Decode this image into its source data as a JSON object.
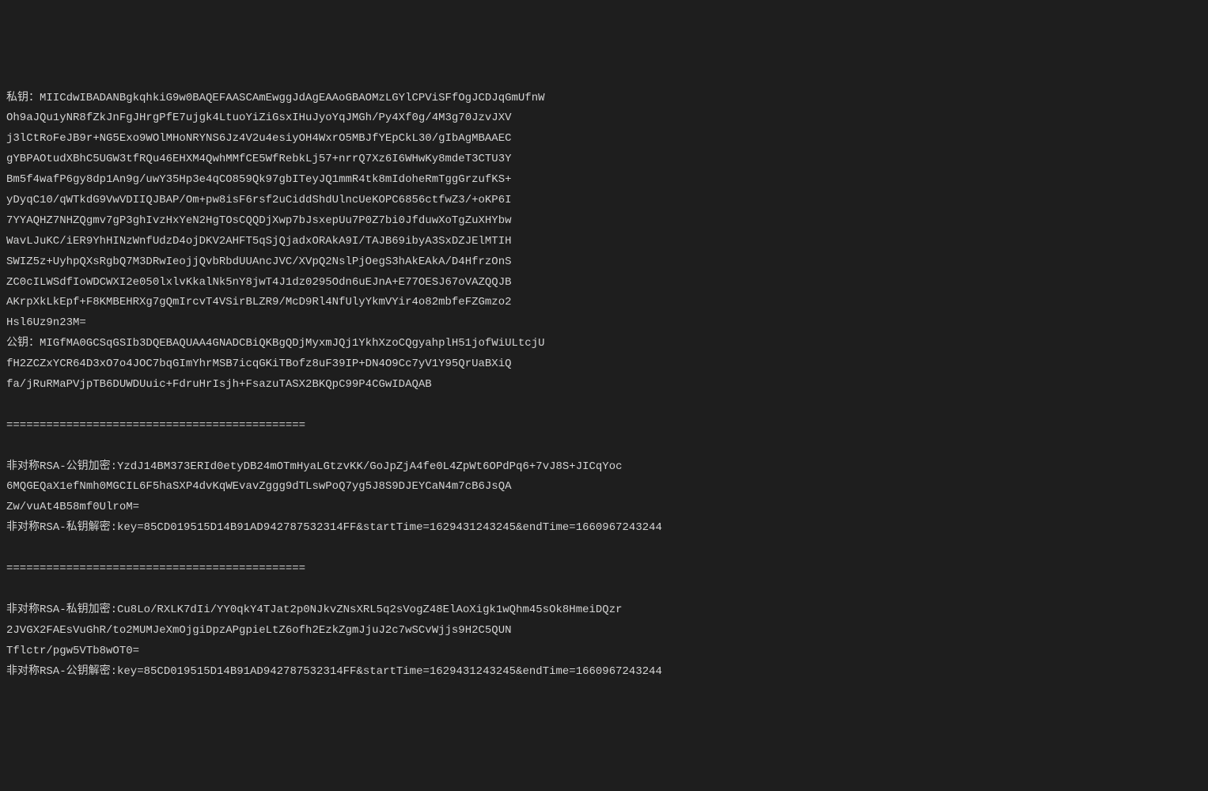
{
  "console": {
    "lines": [
      "私钥：MIICdwIBADANBgkqhkiG9w0BAQEFAASCAmEwggJdAgEAAoGBAOMzLGYlCPViSFfOgJCDJqGmUfnW",
      "Oh9aJQu1yNR8fZkJnFgJHrgPfE7ujgk4LtuoYiZiGsxIHuJyoYqJMGh/Py4Xf0g/4M3g70JzvJXV",
      "j3lCtRoFeJB9r+NG5Exo9WOlMHoNRYNS6Jz4V2u4esiyOH4WxrO5MBJfYEpCkL30/gIbAgMBAAEC",
      "gYBPAOtudXBhC5UGW3tfRQu46EHXM4QwhMMfCE5WfRebkLj57+nrrQ7Xz6I6WHwKy8mdeT3CTU3Y",
      "Bm5f4wafP6gy8dp1An9g/uwY35Hp3e4qCO859Qk97gbITeyJQ1mmR4tk8mIdoheRmTggGrzufKS+",
      "yDyqC10/qWTkdG9VwVDIIQJBAP/Om+pw8isF6rsf2uCiddShdUlncUeKOPC6856ctfwZ3/+oKP6I",
      "7YYAQHZ7NHZQgmv7gP3ghIvzHxYeN2HgTOsCQQDjXwp7bJsxepUu7P0Z7bi0JfduwXoTgZuXHYbw",
      "WavLJuKC/iER9YhHINzWnfUdzD4ojDKV2AHFT5qSjQjadxORAkA9I/TAJB69ibyA3SxDZJElMTIH",
      "SWIZ5z+UyhpQXsRgbQ7M3DRwIeojjQvbRbdUUAncJVC/XVpQ2NslPjOegS3hAkEAkA/D4HfrzOnS",
      "ZC0cILWSdfIoWDCWXI2e050lxlvKkalNk5nY8jwT4J1dz0295Odn6uEJnA+E77OESJ67oVAZQQJB",
      "AKrpXkLkEpf+F8KMBEHRXg7gQmIrcvT4VSirBLZR9/McD9Rl4NfUlyYkmVYir4o82mbfeFZGmzo2",
      "Hsl6Uz9n23M=",
      "公钥：MIGfMA0GCSqGSIb3DQEBAQUAA4GNADCBiQKBgQDjMyxmJQj1YkhXzoCQgyahplH51jofWiULtcjU",
      "fH2ZCZxYCR64D3xO7o4JOC7bqGImYhrMSB7icqGKiTBofz8uF39IP+DN4O9Cc7yV1Y95QrUaBXiQ",
      "fa/jRuRMaPVjpTB6DUWDUuic+FdruHrIsjh+FsazuTASX2BKQpC99P4CGwIDAQAB",
      "",
      "=============================================",
      "",
      "非对称RSA-公钥加密:YzdJ14BM373ERId0etyDB24mOTmHyaLGtzvKK/GoJpZjA4fe0L4ZpWt6OPdPq6+7vJ8S+JICqYoc",
      "6MQGEQaX1efNmh0MGCIL6F5haSXP4dvKqWEvavZggg9dTLswPoQ7yg5J8S9DJEYCaN4m7cB6JsQA",
      "Zw/vuAt4B58mf0UlroM=",
      "非对称RSA-私钥解密:key=85CD019515D14B91AD942787532314FF&startTime=1629431243245&endTime=1660967243244",
      "",
      "=============================================",
      "",
      "非对称RSA-私钥加密:Cu8Lo/RXLK7dIi/YY0qkY4TJat2p0NJkvZNsXRL5q2sVogZ48ElAoXigk1wQhm45sOk8HmeiDQzr",
      "2JVGX2FAEsVuGhR/to2MUMJeXmOjgiDpzAPgpieLtZ6ofh2EzkZgmJjuJ2c7wSCvWjjs9H2C5QUN",
      "Tflctr/pgw5VTb8wOT0=",
      "非对称RSA-公钥解密:key=85CD019515D14B91AD942787532314FF&startTime=1629431243245&endTime=1660967243244"
    ]
  }
}
